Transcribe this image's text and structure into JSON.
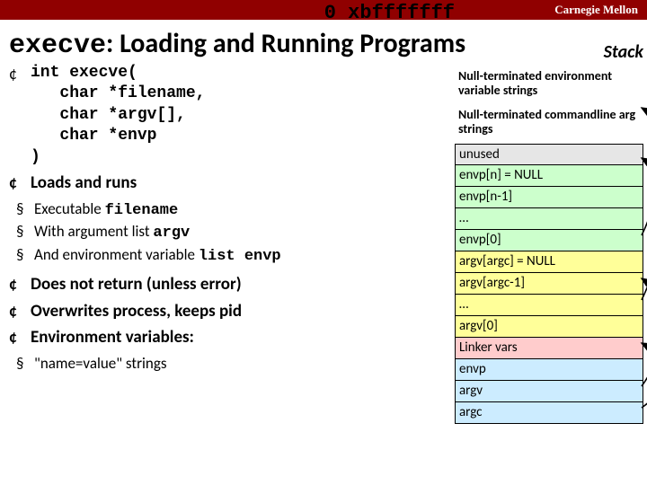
{
  "banner": "Carnegie Mellon",
  "title_code": "execve",
  "title_rest": ": Loading and Running Programs",
  "addr": "0 xbfffffff",
  "stack_label": "Stack",
  "sig": {
    "l1": "int execve(",
    "l2": "   char *filename,",
    "l3": "   char *argv[],",
    "l4": "   char *envp",
    "l5": ")"
  },
  "b2": "Loads and runs",
  "b2s1a": "Executable ",
  "b2s1b": "filename",
  "b2s2a": "With argument list ",
  "b2s2b": "argv",
  "b2s3a": "And environment variable ",
  "b2s3b": "list envp",
  "b3": "Does not return (unless error)",
  "b4": "Overwrites process, keeps pid",
  "b5": "Environment variables:",
  "b5s1": "\"name=value\" strings",
  "note1": "Null-terminated environment variable strings",
  "note2": "Null-terminated commandline arg strings",
  "cells": {
    "unused": "unused",
    "envn": "envp[n] = NULL",
    "envn1": "envp[n-1]",
    "dots": "…",
    "env0": "envp[0]",
    "argc": "argv[argc] = NULL",
    "argc1": "argv[argc-1]",
    "arg0": "argv[0]",
    "linker": "Linker vars",
    "envp": "envp",
    "argv": "argv",
    "argcv": "argc"
  }
}
